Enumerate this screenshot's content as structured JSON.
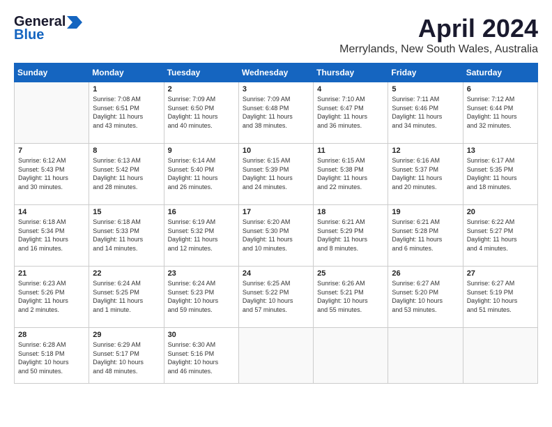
{
  "header": {
    "logo_line1": "General",
    "logo_line2": "Blue",
    "month_year": "April 2024",
    "location": "Merrylands, New South Wales, Australia"
  },
  "weekdays": [
    "Sunday",
    "Monday",
    "Tuesday",
    "Wednesday",
    "Thursday",
    "Friday",
    "Saturday"
  ],
  "weeks": [
    [
      {
        "day": "",
        "info": ""
      },
      {
        "day": "1",
        "info": "Sunrise: 7:08 AM\nSunset: 6:51 PM\nDaylight: 11 hours\nand 43 minutes."
      },
      {
        "day": "2",
        "info": "Sunrise: 7:09 AM\nSunset: 6:50 PM\nDaylight: 11 hours\nand 40 minutes."
      },
      {
        "day": "3",
        "info": "Sunrise: 7:09 AM\nSunset: 6:48 PM\nDaylight: 11 hours\nand 38 minutes."
      },
      {
        "day": "4",
        "info": "Sunrise: 7:10 AM\nSunset: 6:47 PM\nDaylight: 11 hours\nand 36 minutes."
      },
      {
        "day": "5",
        "info": "Sunrise: 7:11 AM\nSunset: 6:46 PM\nDaylight: 11 hours\nand 34 minutes."
      },
      {
        "day": "6",
        "info": "Sunrise: 7:12 AM\nSunset: 6:44 PM\nDaylight: 11 hours\nand 32 minutes."
      }
    ],
    [
      {
        "day": "7",
        "info": "Sunrise: 6:12 AM\nSunset: 5:43 PM\nDaylight: 11 hours\nand 30 minutes."
      },
      {
        "day": "8",
        "info": "Sunrise: 6:13 AM\nSunset: 5:42 PM\nDaylight: 11 hours\nand 28 minutes."
      },
      {
        "day": "9",
        "info": "Sunrise: 6:14 AM\nSunset: 5:40 PM\nDaylight: 11 hours\nand 26 minutes."
      },
      {
        "day": "10",
        "info": "Sunrise: 6:15 AM\nSunset: 5:39 PM\nDaylight: 11 hours\nand 24 minutes."
      },
      {
        "day": "11",
        "info": "Sunrise: 6:15 AM\nSunset: 5:38 PM\nDaylight: 11 hours\nand 22 minutes."
      },
      {
        "day": "12",
        "info": "Sunrise: 6:16 AM\nSunset: 5:37 PM\nDaylight: 11 hours\nand 20 minutes."
      },
      {
        "day": "13",
        "info": "Sunrise: 6:17 AM\nSunset: 5:35 PM\nDaylight: 11 hours\nand 18 minutes."
      }
    ],
    [
      {
        "day": "14",
        "info": "Sunrise: 6:18 AM\nSunset: 5:34 PM\nDaylight: 11 hours\nand 16 minutes."
      },
      {
        "day": "15",
        "info": "Sunrise: 6:18 AM\nSunset: 5:33 PM\nDaylight: 11 hours\nand 14 minutes."
      },
      {
        "day": "16",
        "info": "Sunrise: 6:19 AM\nSunset: 5:32 PM\nDaylight: 11 hours\nand 12 minutes."
      },
      {
        "day": "17",
        "info": "Sunrise: 6:20 AM\nSunset: 5:30 PM\nDaylight: 11 hours\nand 10 minutes."
      },
      {
        "day": "18",
        "info": "Sunrise: 6:21 AM\nSunset: 5:29 PM\nDaylight: 11 hours\nand 8 minutes."
      },
      {
        "day": "19",
        "info": "Sunrise: 6:21 AM\nSunset: 5:28 PM\nDaylight: 11 hours\nand 6 minutes."
      },
      {
        "day": "20",
        "info": "Sunrise: 6:22 AM\nSunset: 5:27 PM\nDaylight: 11 hours\nand 4 minutes."
      }
    ],
    [
      {
        "day": "21",
        "info": "Sunrise: 6:23 AM\nSunset: 5:26 PM\nDaylight: 11 hours\nand 2 minutes."
      },
      {
        "day": "22",
        "info": "Sunrise: 6:24 AM\nSunset: 5:25 PM\nDaylight: 11 hours\nand 1 minute."
      },
      {
        "day": "23",
        "info": "Sunrise: 6:24 AM\nSunset: 5:23 PM\nDaylight: 10 hours\nand 59 minutes."
      },
      {
        "day": "24",
        "info": "Sunrise: 6:25 AM\nSunset: 5:22 PM\nDaylight: 10 hours\nand 57 minutes."
      },
      {
        "day": "25",
        "info": "Sunrise: 6:26 AM\nSunset: 5:21 PM\nDaylight: 10 hours\nand 55 minutes."
      },
      {
        "day": "26",
        "info": "Sunrise: 6:27 AM\nSunset: 5:20 PM\nDaylight: 10 hours\nand 53 minutes."
      },
      {
        "day": "27",
        "info": "Sunrise: 6:27 AM\nSunset: 5:19 PM\nDaylight: 10 hours\nand 51 minutes."
      }
    ],
    [
      {
        "day": "28",
        "info": "Sunrise: 6:28 AM\nSunset: 5:18 PM\nDaylight: 10 hours\nand 50 minutes."
      },
      {
        "day": "29",
        "info": "Sunrise: 6:29 AM\nSunset: 5:17 PM\nDaylight: 10 hours\nand 48 minutes."
      },
      {
        "day": "30",
        "info": "Sunrise: 6:30 AM\nSunset: 5:16 PM\nDaylight: 10 hours\nand 46 minutes."
      },
      {
        "day": "",
        "info": ""
      },
      {
        "day": "",
        "info": ""
      },
      {
        "day": "",
        "info": ""
      },
      {
        "day": "",
        "info": ""
      }
    ]
  ]
}
